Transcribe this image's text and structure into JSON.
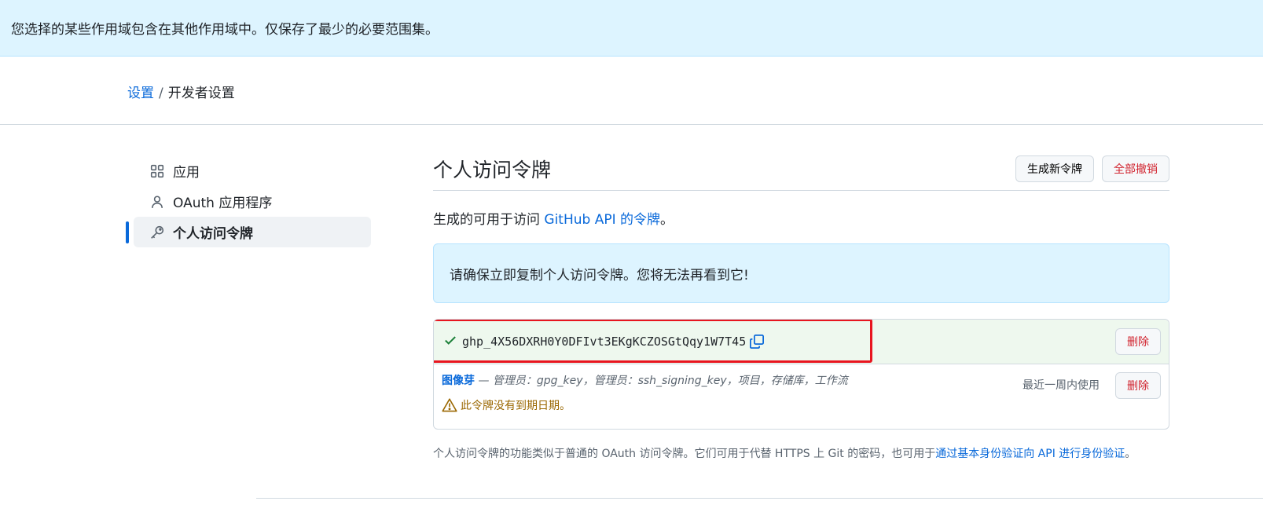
{
  "flash": {
    "message": "您选择的某些作用域包含在其他作用域中。仅保存了最少的必要范围集。"
  },
  "breadcrumb": {
    "parent": "设置",
    "separator": "/",
    "current": "开发者设置"
  },
  "sidebar": {
    "items": [
      {
        "label": "应用",
        "icon": "apps-grid-icon"
      },
      {
        "label": "OAuth 应用程序",
        "icon": "person-icon"
      },
      {
        "label": "个人访问令牌",
        "icon": "key-icon",
        "active": true
      }
    ]
  },
  "main": {
    "title": "个人访问令牌",
    "generate_button": "生成新令牌",
    "revoke_all_button": "全部撤销",
    "description_prefix": "生成的可用于访问 ",
    "description_link": "GitHub API 的令牌",
    "description_suffix": "。",
    "notice": "请确保立即复制个人访问令牌。您将无法再看到它!",
    "token": {
      "value": "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",
      "delete_label": "删除",
      "name": "图像芽",
      "scopes": " — 管理员：gpg_key，管理员：ssh_signing_key，项目，存储库，工作流",
      "last_used": "最近一周内使用",
      "delete_label_2": "删除",
      "expiry_warning": "此令牌没有到期日期。"
    },
    "footnote_text": "个人访问令牌的功能类似于普通的 OAuth 访问令牌。它们可用于代替 HTTPS 上 Git 的密码，也可用于",
    "footnote_link": "通过基本身份验证向 API 进行身份验证",
    "footnote_end": "。"
  },
  "colors": {
    "accent": "#0969da",
    "danger": "#d1242f",
    "success": "#1a7f37",
    "warning": "#9a6700",
    "highlight": "#e8151f"
  }
}
